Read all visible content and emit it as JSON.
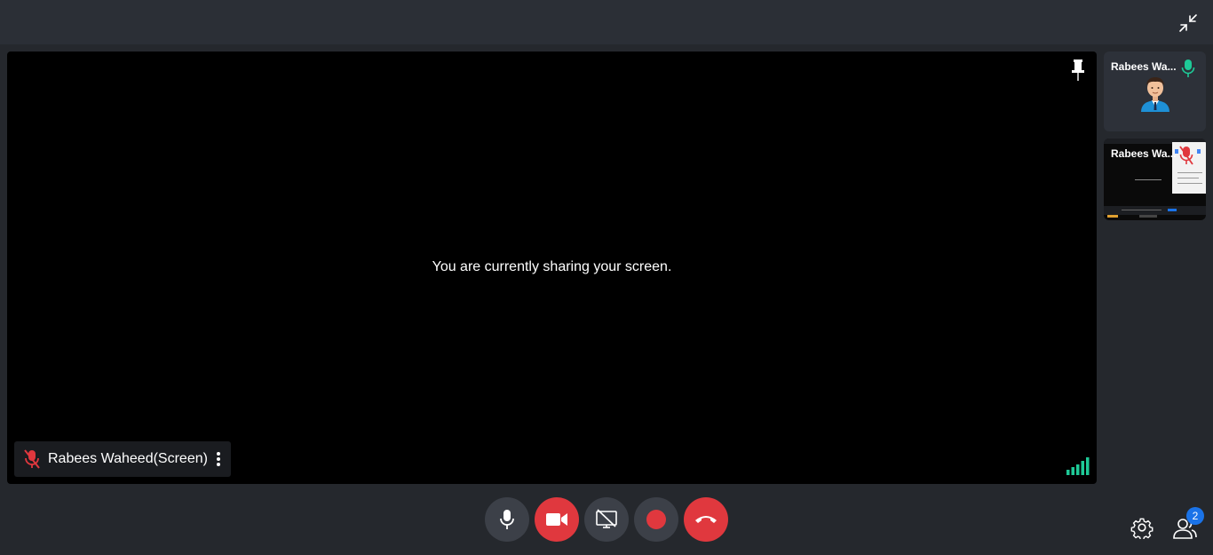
{
  "topbar": {
    "exit_fullscreen_icon": "exit-fullscreen-icon"
  },
  "stage": {
    "message": "You are currently sharing your screen.",
    "presenter_label": "Rabees Waheed(Screen)",
    "presenter_mic": "mic-muted-icon",
    "pin_icon": "pin-icon",
    "more_icon": "more-vertical-icon",
    "signal_icon": "signal-strength-icon"
  },
  "participants": [
    {
      "name": "Rabees Wa...",
      "mic": "mic-on-icon",
      "kind": "avatar"
    },
    {
      "name": "Rabees Wa...",
      "mic": "mic-muted-icon",
      "kind": "screen"
    }
  ],
  "controls": [
    {
      "name": "microphone",
      "icon": "mic-icon",
      "state": "on"
    },
    {
      "name": "camera",
      "icon": "camera-icon",
      "state": "off"
    },
    {
      "name": "screen-share",
      "icon": "stop-screen-share-icon",
      "state": "sharing"
    },
    {
      "name": "record",
      "icon": "record-icon",
      "state": "idle"
    },
    {
      "name": "leave",
      "icon": "hang-up-icon",
      "state": ""
    }
  ],
  "footer": {
    "participant_count": "2"
  },
  "colors": {
    "background": "#25282d",
    "topbar": "#2b2f36",
    "danger": "#e0383e",
    "control_dark": "#3c4048",
    "mic_on": "#1ec997",
    "badge": "#1a73e8"
  }
}
